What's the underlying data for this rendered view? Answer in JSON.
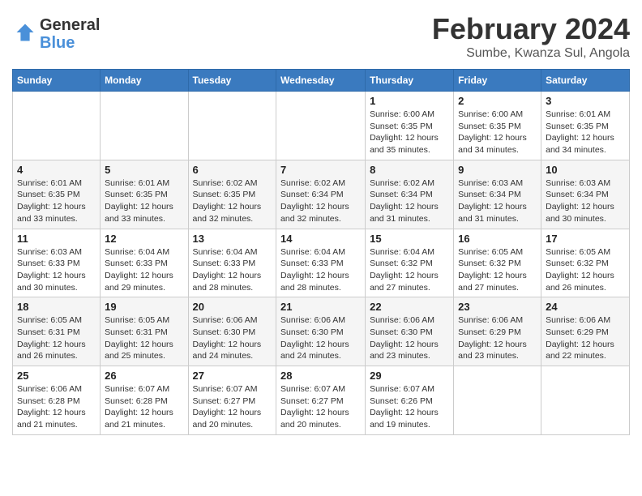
{
  "header": {
    "logo_general": "General",
    "logo_blue": "Blue",
    "month_year": "February 2024",
    "location": "Sumbe, Kwanza Sul, Angola"
  },
  "days_of_week": [
    "Sunday",
    "Monday",
    "Tuesday",
    "Wednesday",
    "Thursday",
    "Friday",
    "Saturday"
  ],
  "weeks": [
    [
      {
        "day": "",
        "info": ""
      },
      {
        "day": "",
        "info": ""
      },
      {
        "day": "",
        "info": ""
      },
      {
        "day": "",
        "info": ""
      },
      {
        "day": "1",
        "info": "Sunrise: 6:00 AM\nSunset: 6:35 PM\nDaylight: 12 hours\nand 35 minutes."
      },
      {
        "day": "2",
        "info": "Sunrise: 6:00 AM\nSunset: 6:35 PM\nDaylight: 12 hours\nand 34 minutes."
      },
      {
        "day": "3",
        "info": "Sunrise: 6:01 AM\nSunset: 6:35 PM\nDaylight: 12 hours\nand 34 minutes."
      }
    ],
    [
      {
        "day": "4",
        "info": "Sunrise: 6:01 AM\nSunset: 6:35 PM\nDaylight: 12 hours\nand 33 minutes."
      },
      {
        "day": "5",
        "info": "Sunrise: 6:01 AM\nSunset: 6:35 PM\nDaylight: 12 hours\nand 33 minutes."
      },
      {
        "day": "6",
        "info": "Sunrise: 6:02 AM\nSunset: 6:35 PM\nDaylight: 12 hours\nand 32 minutes."
      },
      {
        "day": "7",
        "info": "Sunrise: 6:02 AM\nSunset: 6:34 PM\nDaylight: 12 hours\nand 32 minutes."
      },
      {
        "day": "8",
        "info": "Sunrise: 6:02 AM\nSunset: 6:34 PM\nDaylight: 12 hours\nand 31 minutes."
      },
      {
        "day": "9",
        "info": "Sunrise: 6:03 AM\nSunset: 6:34 PM\nDaylight: 12 hours\nand 31 minutes."
      },
      {
        "day": "10",
        "info": "Sunrise: 6:03 AM\nSunset: 6:34 PM\nDaylight: 12 hours\nand 30 minutes."
      }
    ],
    [
      {
        "day": "11",
        "info": "Sunrise: 6:03 AM\nSunset: 6:33 PM\nDaylight: 12 hours\nand 30 minutes."
      },
      {
        "day": "12",
        "info": "Sunrise: 6:04 AM\nSunset: 6:33 PM\nDaylight: 12 hours\nand 29 minutes."
      },
      {
        "day": "13",
        "info": "Sunrise: 6:04 AM\nSunset: 6:33 PM\nDaylight: 12 hours\nand 28 minutes."
      },
      {
        "day": "14",
        "info": "Sunrise: 6:04 AM\nSunset: 6:33 PM\nDaylight: 12 hours\nand 28 minutes."
      },
      {
        "day": "15",
        "info": "Sunrise: 6:04 AM\nSunset: 6:32 PM\nDaylight: 12 hours\nand 27 minutes."
      },
      {
        "day": "16",
        "info": "Sunrise: 6:05 AM\nSunset: 6:32 PM\nDaylight: 12 hours\nand 27 minutes."
      },
      {
        "day": "17",
        "info": "Sunrise: 6:05 AM\nSunset: 6:32 PM\nDaylight: 12 hours\nand 26 minutes."
      }
    ],
    [
      {
        "day": "18",
        "info": "Sunrise: 6:05 AM\nSunset: 6:31 PM\nDaylight: 12 hours\nand 26 minutes."
      },
      {
        "day": "19",
        "info": "Sunrise: 6:05 AM\nSunset: 6:31 PM\nDaylight: 12 hours\nand 25 minutes."
      },
      {
        "day": "20",
        "info": "Sunrise: 6:06 AM\nSunset: 6:30 PM\nDaylight: 12 hours\nand 24 minutes."
      },
      {
        "day": "21",
        "info": "Sunrise: 6:06 AM\nSunset: 6:30 PM\nDaylight: 12 hours\nand 24 minutes."
      },
      {
        "day": "22",
        "info": "Sunrise: 6:06 AM\nSunset: 6:30 PM\nDaylight: 12 hours\nand 23 minutes."
      },
      {
        "day": "23",
        "info": "Sunrise: 6:06 AM\nSunset: 6:29 PM\nDaylight: 12 hours\nand 23 minutes."
      },
      {
        "day": "24",
        "info": "Sunrise: 6:06 AM\nSunset: 6:29 PM\nDaylight: 12 hours\nand 22 minutes."
      }
    ],
    [
      {
        "day": "25",
        "info": "Sunrise: 6:06 AM\nSunset: 6:28 PM\nDaylight: 12 hours\nand 21 minutes."
      },
      {
        "day": "26",
        "info": "Sunrise: 6:07 AM\nSunset: 6:28 PM\nDaylight: 12 hours\nand 21 minutes."
      },
      {
        "day": "27",
        "info": "Sunrise: 6:07 AM\nSunset: 6:27 PM\nDaylight: 12 hours\nand 20 minutes."
      },
      {
        "day": "28",
        "info": "Sunrise: 6:07 AM\nSunset: 6:27 PM\nDaylight: 12 hours\nand 20 minutes."
      },
      {
        "day": "29",
        "info": "Sunrise: 6:07 AM\nSunset: 6:26 PM\nDaylight: 12 hours\nand 19 minutes."
      },
      {
        "day": "",
        "info": ""
      },
      {
        "day": "",
        "info": ""
      }
    ]
  ]
}
